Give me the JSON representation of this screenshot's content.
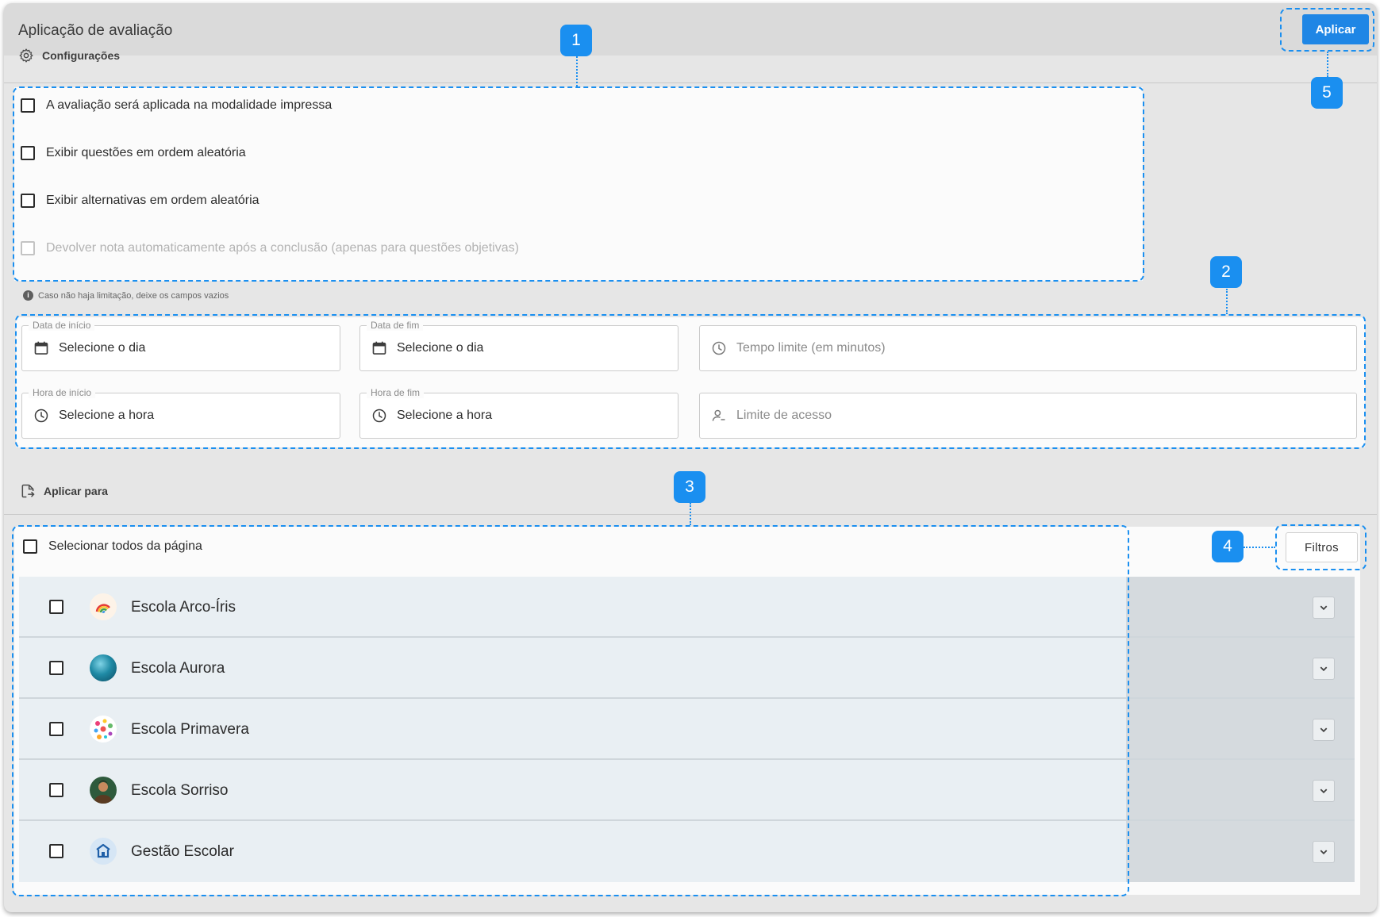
{
  "header": {
    "title": "Aplicação de avaliação",
    "apply_label": "Aplicar"
  },
  "settings": {
    "heading": "Configurações",
    "options": [
      {
        "label": "A avaliação será aplicada na modalidade impressa",
        "checked": false,
        "disabled": false
      },
      {
        "label": "Exibir questões em ordem aleatória",
        "checked": false,
        "disabled": false
      },
      {
        "label": "Exibir alternativas em ordem aleatória",
        "checked": false,
        "disabled": false
      },
      {
        "label": "Devolver nota automaticamente após a conclusão (apenas para questões objetivas)",
        "checked": false,
        "disabled": true
      }
    ],
    "hint": "Caso não haja limitação, deixe os campos vazios"
  },
  "fields": {
    "start_date": {
      "label": "Data de início",
      "value": "Selecione o dia"
    },
    "end_date": {
      "label": "Data de fim",
      "value": "Selecione o dia"
    },
    "time_limit": {
      "placeholder": "Tempo limite (em minutos)"
    },
    "start_time": {
      "label": "Hora de início",
      "value": "Selecione a hora"
    },
    "end_time": {
      "label": "Hora de fim",
      "value": "Selecione a hora"
    },
    "access_limit": {
      "placeholder": "Limite de acesso"
    }
  },
  "apply_to": {
    "heading": "Aplicar para",
    "select_all_label": "Selecionar todos da página",
    "filters_label": "Filtros",
    "schools": [
      {
        "name": "Escola Arco-Íris",
        "checked": false
      },
      {
        "name": "Escola Aurora",
        "checked": false
      },
      {
        "name": "Escola Primavera",
        "checked": false
      },
      {
        "name": "Escola Sorriso",
        "checked": false
      },
      {
        "name": "Gestão Escolar",
        "checked": false
      }
    ]
  },
  "annotations": [
    "1",
    "2",
    "3",
    "4",
    "5"
  ],
  "colors": {
    "primary": "#1f86e5",
    "annotation": "#1a8ff0",
    "row_bg": "#e9eff3"
  },
  "icons": [
    "gear-icon",
    "calendar-icon",
    "clock-icon",
    "user-icon",
    "share-file-icon",
    "chevron-down-icon",
    "info-icon"
  ]
}
